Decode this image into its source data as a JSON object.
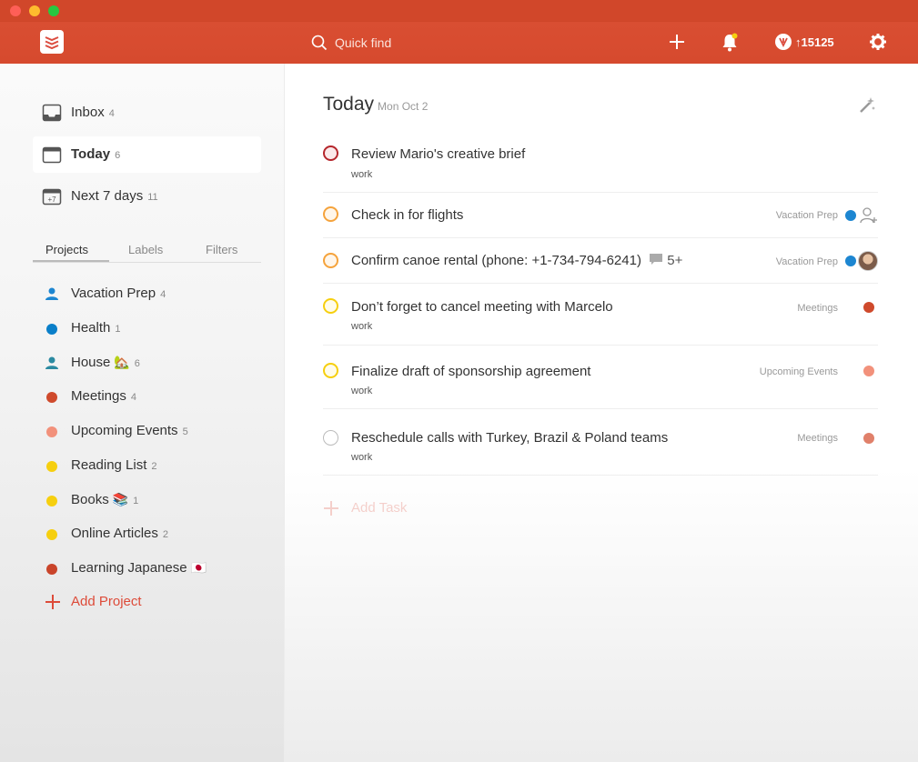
{
  "header": {
    "search_placeholder": "Quick find",
    "karma": "↑15125"
  },
  "sidebar": {
    "nav": [
      {
        "label": "Inbox",
        "count": "4"
      },
      {
        "label": "Today",
        "count": "6"
      },
      {
        "label": "Next 7 days",
        "count": "11"
      }
    ],
    "tabs": [
      "Projects",
      "Labels",
      "Filters"
    ],
    "projects": [
      {
        "label": "Vacation Prep",
        "count": "4",
        "emoji": "",
        "icon": "person-icon",
        "color": "#1d86d1"
      },
      {
        "label": "Health",
        "count": "1",
        "emoji": "",
        "icon": "dot",
        "color": "#0a7fc9"
      },
      {
        "label": "House",
        "count": "6",
        "emoji": "🏡",
        "icon": "person-icon",
        "color": "#2b8aa1"
      },
      {
        "label": "Meetings",
        "count": "4",
        "emoji": "",
        "icon": "dot",
        "color": "#cf4a2c"
      },
      {
        "label": "Upcoming Events",
        "count": "5",
        "emoji": "",
        "icon": "dot",
        "color": "#f2917b"
      },
      {
        "label": "Reading List",
        "count": "2",
        "emoji": "",
        "icon": "dot",
        "color": "#f6cf0f"
      },
      {
        "label": "Books",
        "count": "1",
        "emoji": "📚",
        "icon": "dot",
        "color": "#f6cf0f"
      },
      {
        "label": "Online Articles",
        "count": "2",
        "emoji": "",
        "icon": "dot",
        "color": "#f6cf0f"
      },
      {
        "label": "Learning Japanese",
        "count": "",
        "emoji": "🇯🇵",
        "icon": "dot",
        "color": "#c9442a"
      }
    ],
    "add_project": "Add Project"
  },
  "main": {
    "title": "Today",
    "date": "Mon Oct 2",
    "tasks": [
      {
        "title": "Review Mario's creative brief",
        "sub": "work",
        "project": "",
        "priority_color": "#b5262c"
      },
      {
        "title": "Check in for flights",
        "sub": "",
        "project": "Vacation Prep",
        "priority_color": "#f5a33c",
        "project_color": "#1d86d1"
      },
      {
        "title": "Confirm canoe rental (phone: +1-734-794-6241)",
        "comments": "5+",
        "sub": "",
        "project": "Vacation Prep",
        "priority_color": "#f5a33c",
        "project_color": "#1d86d1"
      },
      {
        "title": "Don’t forget to cancel meeting with Marcelo",
        "sub": "work",
        "project": "Meetings",
        "priority_color": "#f6cf0f",
        "project_color": "#cf4a2c"
      },
      {
        "title": "Finalize draft of sponsorship agreement",
        "sub": "work",
        "project": "Upcoming Events",
        "priority_color": "#f6cf0f",
        "project_color": "#f2917b"
      },
      {
        "title": "Reschedule calls with Turkey, Brazil & Poland teams",
        "sub": "work",
        "project": "Meetings",
        "priority_color": "#bbbbbb",
        "project_color": "#e0806a"
      }
    ],
    "add_task": "Add Task"
  },
  "colors": {
    "brand": "#db4c3f",
    "accent": "#dd4b39"
  }
}
